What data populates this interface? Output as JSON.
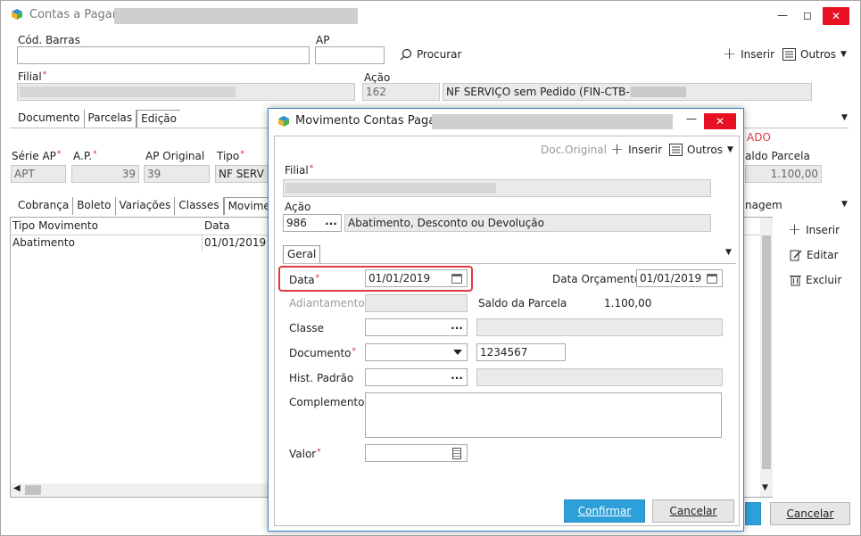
{
  "main": {
    "title": "Contas a Pagar",
    "header": {
      "cod_barras_label": "Cód. Barras",
      "ap_label": "AP",
      "procurar": "Procurar",
      "inserir": "Inserir",
      "outros": "Outros",
      "filial_label": "Filial",
      "acao_label": "Ação",
      "acao_code": "162",
      "acao_desc": "NF SERVIÇO sem Pedido (FIN-CTB-PAT)"
    },
    "tabs": [
      "Documento",
      "Parcelas",
      "Edição"
    ],
    "status_fragment": "ADO",
    "fields": {
      "serie_ap_label": "Série AP",
      "serie_ap": "APT",
      "ap_label": "A.P.",
      "ap_value": "39",
      "ap_original_label": "AP Original",
      "ap_original": "39",
      "tipo_label": "Tipo",
      "tipo_value": "NF SERV",
      "saldo_parcela_label": "aldo Parcela",
      "saldo_parcela": "1.100,00"
    },
    "subtabs": [
      "Cobrança",
      "Boleto",
      "Variações",
      "Classes",
      "Movimenta"
    ],
    "subtab_right_fragment": "nagem",
    "grid": {
      "columns": [
        "Tipo Movimento",
        "Data"
      ],
      "rows": [
        [
          "Abatimento",
          "01/01/2019"
        ]
      ]
    },
    "side_actions": [
      "Inserir",
      "Editar",
      "Excluir"
    ],
    "cancel": "Cancelar"
  },
  "dialog": {
    "title": "Movimento Contas Pagar",
    "doc_original": "Doc.Original",
    "inserir": "Inserir",
    "outros": "Outros",
    "filial_label": "Filial",
    "acao_label": "Ação",
    "acao_code": "986",
    "acao_desc": "Abatimento, Desconto ou Devolução",
    "tab": "Geral",
    "data_label": "Data",
    "data_value": "01/01/2019",
    "data_orcamento_label": "Data Orçamento",
    "data_orcamento_value": "01/01/2019",
    "adiantamento_label": "Adiantamento",
    "saldo_parcela_label": "Saldo da Parcela",
    "saldo_parcela_value": "1.100,00",
    "classe_label": "Classe",
    "documento_label": "Documento",
    "documento_value": "1234567",
    "hist_padrao_label": "Hist. Padrão",
    "complemento_label": "Complemento",
    "valor_label": "Valor",
    "confirmar": "Confirmar",
    "cancelar": "Cancelar"
  },
  "colors": {
    "accent": "#2d9fd9",
    "highlight_border": "#e0393e",
    "required": "#dd2222",
    "close": "#e81123"
  }
}
